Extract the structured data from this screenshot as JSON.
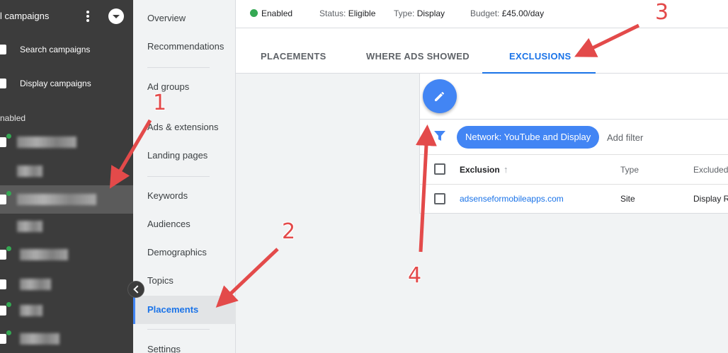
{
  "sidebar": {
    "title": "l campaigns",
    "nav": [
      {
        "label": "Search campaigns",
        "icon": "search-campaign-icon"
      },
      {
        "label": "Display campaigns",
        "icon": "display-campaign-icon"
      }
    ],
    "section_label": "nabled",
    "campaigns": [
      {
        "icon": "display-campaign-icon",
        "blurred": true
      },
      {
        "icon": "none",
        "blurred": true
      },
      {
        "icon": "display-campaign-icon",
        "blurred": true,
        "selected": true
      },
      {
        "icon": "none",
        "blurred": true
      },
      {
        "icon": "search-campaign-icon",
        "blurred": true
      },
      {
        "icon": "search-campaign-icon",
        "blurred": true
      },
      {
        "icon": "search-campaign-icon",
        "blurred": true
      },
      {
        "icon": "search-campaign-icon",
        "blurred": true
      }
    ]
  },
  "subnav": {
    "items": [
      {
        "label": "Overview"
      },
      {
        "label": "Recommendations"
      },
      {
        "label": "Ad groups"
      },
      {
        "label": "Ads & extensions"
      },
      {
        "label": "Landing pages"
      },
      {
        "label": "Keywords"
      },
      {
        "label": "Audiences"
      },
      {
        "label": "Demographics"
      },
      {
        "label": "Topics"
      },
      {
        "label": "Placements",
        "active": true
      },
      {
        "label": "Settings"
      }
    ]
  },
  "status_bar": {
    "enabled": "Enabled",
    "status_label": "Status:",
    "status_value": "Eligible",
    "type_label": "Type:",
    "type_value": "Display",
    "budget_label": "Budget:",
    "budget_value": "£45.00/day"
  },
  "tabs": [
    {
      "label": "PLACEMENTS"
    },
    {
      "label": "WHERE ADS SHOWED"
    },
    {
      "label": "EXCLUSIONS",
      "active": true
    }
  ],
  "filter": {
    "chip": "Network: YouTube and Display",
    "add_filter": "Add filter"
  },
  "table": {
    "headers": [
      "Exclusion",
      "Type",
      "Excluded"
    ],
    "rows": [
      {
        "exclusion": "adsenseformobileapps.com",
        "type": "Site",
        "excluded": "Display R"
      }
    ]
  },
  "annotations": [
    "1",
    "2",
    "3",
    "4"
  ],
  "colors": {
    "accent": "#1a73e8",
    "arrow": "#e34a4a",
    "enabled": "#34a853",
    "sidebar": "#3c3c3c"
  }
}
